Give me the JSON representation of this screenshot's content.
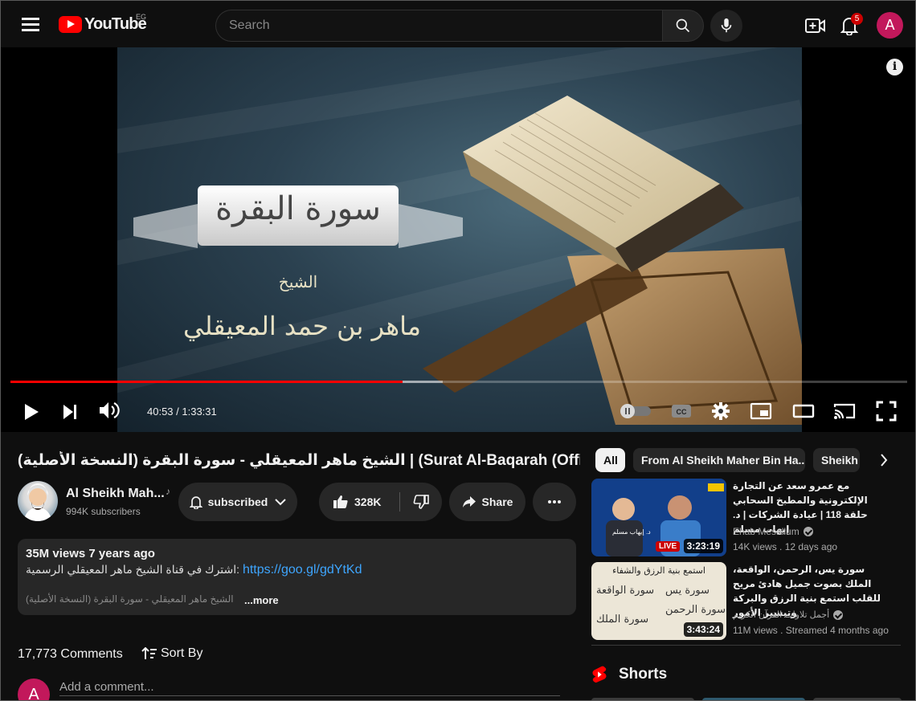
{
  "header": {
    "logo_text": "YouTube",
    "country_code": "EG",
    "search_placeholder": "Search",
    "notification_count": "5",
    "avatar_letter": "A"
  },
  "player": {
    "current_time": "40:53",
    "duration": "1:33:31",
    "time_display": "40:53 / 1:33:31",
    "played_fraction": 0.437,
    "buffered_fraction": 0.482,
    "art_sura_title": "سورة البقرة",
    "art_sheikh_label": "الشيخ",
    "art_sheikh_name": "ماهر بن حمد المعيقلي"
  },
  "video": {
    "title": "الشيخ ماهر المعيقلي - سورة البقرة (النسخة الأصلية) | (Surat Al-Baqarah (Official Audio",
    "channel_name": "Al Sheikh Mah...",
    "subscribers": "994K subscribers",
    "subscribe_label": "subscribed",
    "likes": "328K",
    "share_label": "Share",
    "more_icon": "more-horizontal-icon"
  },
  "description": {
    "views_age": "35M views  7 years ago",
    "line1_text": "اشترك في قناة الشيخ ماهر المعيقلي الرسمية:",
    "line1_link": "https://goo.gl/gdYtKd",
    "line2_text": "الشيخ ماهر المعيقلي - سورة البقرة (النسخة الأصلية)",
    "more_label": "...more"
  },
  "comments": {
    "count_label": "17,773 Comments",
    "sort_label": "Sort By",
    "input_placeholder": "Add a comment...",
    "avatar_letter": "A"
  },
  "chips": [
    {
      "label": "All"
    },
    {
      "label": "From Al Sheikh Maher Bin Ha..."
    },
    {
      "label": "Sheikh"
    }
  ],
  "recommendations": [
    {
      "title": "مع عمرو سعد عن التجارة الإلكترونية والمطبخ السحابي حلقة 118 | عيادة الشركات | د. إيهاب مسلم",
      "channel": "Ehab Mesallum",
      "meta": "14K views . 12 days ago",
      "duration": "3:23:19",
      "badge": "LIVE",
      "thumb_caption": "د. إيهاب مسلم"
    },
    {
      "title": "سورة يس، الرحمن، الواقعة، الملك بصوت جميل هادئ مريح للقلب استمع بنية الرزق والبركة وتيسير الأمور",
      "channel": "أجمل تلاوات القرآن الكريم",
      "meta": "11M views . Streamed 4 months ago",
      "duration": "3:43:24",
      "thumb_caption": "استمع بنية الرزق والشفاء",
      "thumb_suras": [
        "سورة يس",
        "سورة الواقعة",
        "سورة الرحمن",
        "سورة الملك"
      ]
    }
  ],
  "shorts": {
    "label": "Shorts"
  },
  "colors": {
    "background": "#0f0f0f",
    "accent_red": "#ff0000",
    "link_blue": "#3ea6ff",
    "pill_gray": "#272727",
    "avatar_pink": "#c2185b"
  }
}
